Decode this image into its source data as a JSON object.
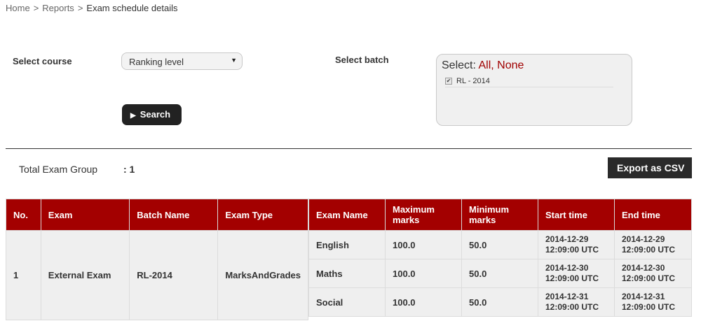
{
  "breadcrumb": {
    "home": "Home",
    "sep": ">",
    "reports": "Reports",
    "current": "Exam schedule details"
  },
  "filters": {
    "course_label": "Select course",
    "course_value": "Ranking level",
    "batch_label": "Select batch",
    "batch_select_prefix": "Select:",
    "batch_all": "All",
    "batch_separator": ",",
    "batch_none": "None",
    "batch_item": "RL - 2014",
    "search_label": "Search"
  },
  "summary": {
    "total_label": "Total Exam Group",
    "total_value": ": 1",
    "export_label": "Export as CSV"
  },
  "table": {
    "headers_left": [
      "No.",
      "Exam",
      "Batch Name",
      "Exam Type"
    ],
    "row_left": [
      "1",
      "External Exam",
      "RL-2014",
      "MarksAndGrades"
    ],
    "headers_right": [
      "Exam Name",
      "Maximum marks",
      "Minimum marks",
      "Start time",
      "End time"
    ],
    "rows_right": [
      [
        "English",
        "100.0",
        "50.0",
        "2014-12-29 12:09:00 UTC",
        "2014-12-29 12:09:00 UTC"
      ],
      [
        "Maths",
        "100.0",
        "50.0",
        "2014-12-30 12:09:00 UTC",
        "2014-12-30 12:09:00 UTC"
      ],
      [
        "Social",
        "100.0",
        "50.0",
        "2014-12-31 12:09:00 UTC",
        "2014-12-31 12:09:00 UTC"
      ]
    ]
  },
  "colors": {
    "accent": "#a30000",
    "link": "#a00000",
    "dark_button": "#222222"
  },
  "icons": {
    "dropdown": "chevron-down-icon",
    "search": "play-icon",
    "checkbox": "checkbox-checked-icon"
  }
}
